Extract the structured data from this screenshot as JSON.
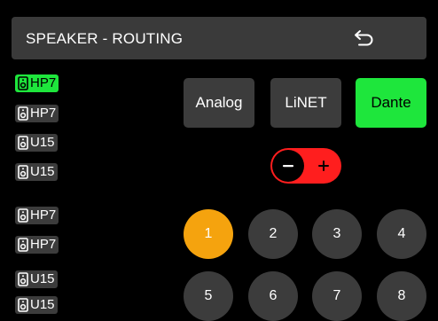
{
  "header": {
    "title": "SPEAKER - ROUTING",
    "back_icon": "undo-arrow-icon"
  },
  "speakers": [
    {
      "label": "HP7",
      "selected": true
    },
    {
      "label": "HP7",
      "selected": false
    },
    {
      "label": "U15",
      "selected": false
    },
    {
      "label": "U15",
      "selected": false
    },
    {
      "label": "HP7",
      "selected": false
    },
    {
      "label": "HP7",
      "selected": false
    },
    {
      "label": "U15",
      "selected": false
    },
    {
      "label": "U15",
      "selected": false
    }
  ],
  "sources": [
    {
      "label": "Analog",
      "selected": false
    },
    {
      "label": "LiNET",
      "selected": false
    },
    {
      "label": "Dante",
      "selected": true
    }
  ],
  "polarity_toggle": {
    "state": "minus",
    "minus_icon": "minus-icon",
    "plus_icon": "plus-icon"
  },
  "channels": [
    {
      "label": "1",
      "selected": true
    },
    {
      "label": "2",
      "selected": false
    },
    {
      "label": "3",
      "selected": false
    },
    {
      "label": "4",
      "selected": false
    },
    {
      "label": "5",
      "selected": false
    },
    {
      "label": "6",
      "selected": false
    },
    {
      "label": "7",
      "selected": false
    },
    {
      "label": "8",
      "selected": false
    }
  ],
  "colors": {
    "background": "#000000",
    "panel": "#3c3c3c",
    "active_green": "#1ee63c",
    "active_orange": "#f5a30e",
    "toggle_red": "#ff1e1e"
  }
}
